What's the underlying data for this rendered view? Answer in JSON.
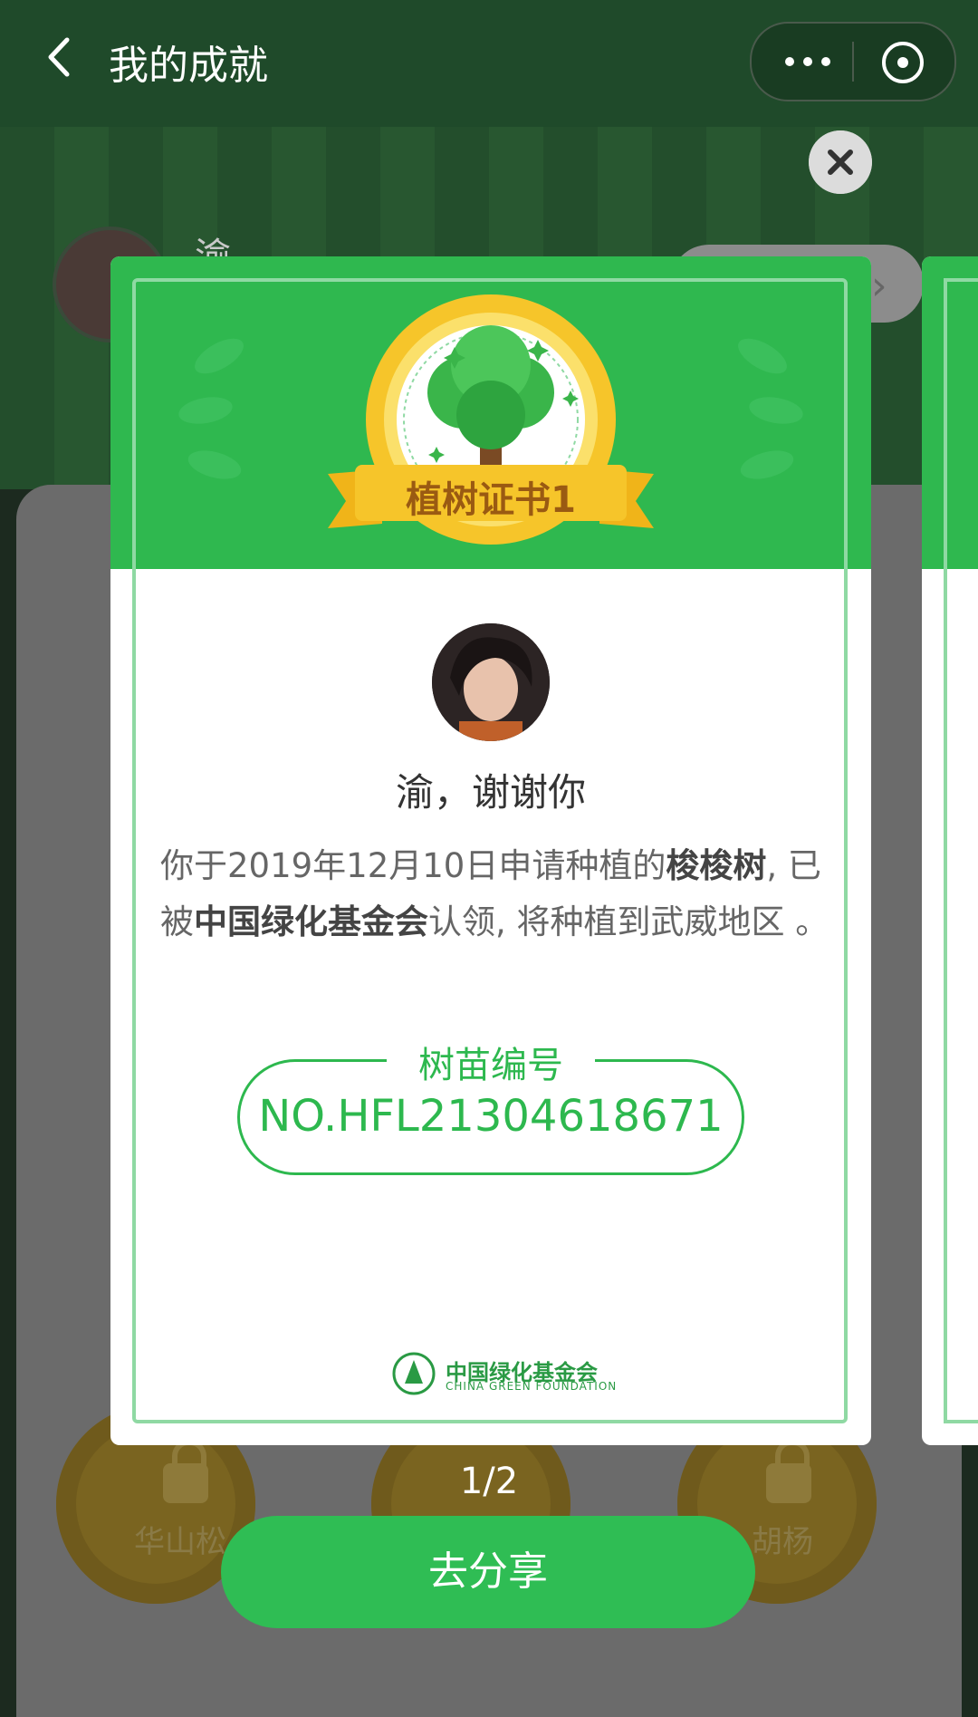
{
  "header": {
    "title": "我的成就",
    "back_icon": "chevron-left-icon",
    "more_icon": "more-icon",
    "exit_icon": "target-close-icon"
  },
  "background": {
    "user_name": "渝",
    "labels": [
      "华山松",
      "胡杨"
    ]
  },
  "certificate": {
    "badge_title": "植树证书1",
    "thanks": "渝，谢谢你",
    "body": {
      "prefix": "你于2019年12月10日申请种植的",
      "tree": "梭梭树",
      "mid": ", 已被",
      "org": "中国绿化基金会",
      "suffix": "认领, 将种植到武威地区 。"
    },
    "serial_label": "树苗编号",
    "serial_value": "NO.HFL21304618671",
    "foundation_cn": "中国绿化基金会",
    "foundation_en": "CHINA GREEN FOUNDATION"
  },
  "pager": "1/2",
  "share_button": "去分享",
  "colors": {
    "primary_green": "#2fb84f",
    "badge_gold": "#f6c52a",
    "text_dark": "#333333"
  }
}
